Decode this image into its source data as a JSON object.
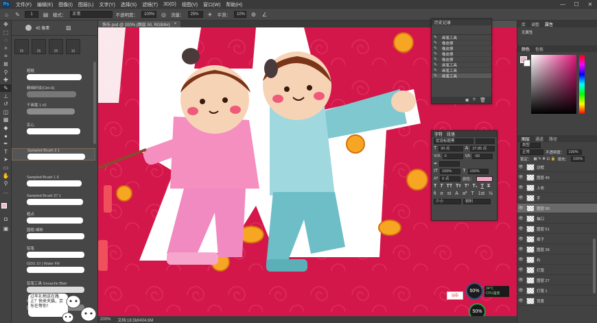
{
  "menubar": {
    "logo": "Ps",
    "items": [
      "文件(F)",
      "编辑(E)",
      "图像(I)",
      "图层(L)",
      "文字(Y)",
      "选择(S)",
      "滤镜(T)",
      "3D(D)",
      "视图(V)",
      "窗口(W)",
      "帮助(H)"
    ],
    "minimize": "—",
    "maximize": "☐",
    "close": "✕"
  },
  "options": {
    "mode_label": "模式：",
    "mode_value": "正常",
    "opacity_label": "不透明度：",
    "opacity_value": "100%",
    "flow_label": "流量：",
    "flow_value": "25%",
    "smooth_label": "平滑：",
    "smooth_value": "10%",
    "brush_size": "1"
  },
  "brushes": {
    "size_value": "45 像素",
    "presets": [
      "25",
      "25",
      "25",
      "10"
    ],
    "items": [
      {
        "name": "粗糙",
        "color": "#ffffff"
      },
      {
        "name": "精细织纹(Ctrl+6)",
        "color": "#9a9a9a"
      },
      {
        "name": "干画笔 1 #2",
        "color": "#bdbdbd"
      },
      {
        "name": "实心",
        "color": "#ffffff"
      },
      {
        "name": "Sampled Brush 3 1",
        "color": "#ffffff"
      },
      {
        "name": "Sampled Brush 1 6",
        "color": "#ffffff"
      },
      {
        "name": "Sampled Brush 37 1",
        "color": "#ffffff"
      },
      {
        "name": "粗点",
        "color": "#ffffff"
      },
      {
        "name": "圆粗-细粉",
        "color": "#ffffff"
      },
      {
        "name": "铅笔",
        "color": "#ffffff"
      },
      {
        "name": "GDG 10 | Water Fill",
        "color": "#ffffff"
      },
      {
        "name": "铅笔工具  Gouache Blair",
        "color": "#dddddd"
      },
      {
        "name": "明暗边缘画笔纹理",
        "color": "#aaaaaa"
      }
    ]
  },
  "doc": {
    "tab_title": "快乐.psd @ 200% (图层 50, RGB/8#)",
    "tab_close": "×",
    "zoom": "200%",
    "doc_info": "文档:18.5M/404.6M"
  },
  "history": {
    "title": "历史记录",
    "items": [
      "画笔工具",
      "橡皮擦",
      "橡皮擦",
      "橡皮擦",
      "橡皮擦",
      "画笔工具",
      "画笔工具",
      "画笔工具"
    ],
    "active_index": 7
  },
  "character": {
    "tabs": [
      "字符",
      "段落"
    ],
    "font": "优设标题黑",
    "size": "30 点",
    "leading": "27.85 点",
    "kerning": "0",
    "tracking": "-50",
    "scale_v": "100%",
    "scale_h": "100%",
    "baseline": "0 点",
    "color_label": "颜色：",
    "color": "#f4a6c8",
    "lang": "英语: 美国",
    "aa": "锐利",
    "letter": "少小"
  },
  "right_dock": {
    "tabs_top": [
      "库",
      "调整",
      "属性"
    ],
    "no_props": "无属性",
    "color_tabs": [
      "颜色",
      "色板"
    ],
    "fg_color": "#f2b8c8",
    "layers_tabs": [
      "图层",
      "通道",
      "路径"
    ],
    "kind": "类型",
    "blend": "正常",
    "opacity_label": "不透明度：",
    "opacity_value": "100%",
    "lock_label": "锁定：",
    "fill_label": "填充：",
    "fill_value": "100%",
    "layers": [
      "边框",
      "图层 49",
      "上衣",
      "手",
      "图层 50",
      "袖口",
      "图层 51",
      "裤子",
      "图层 28",
      "右",
      "灯笼",
      "图层 27",
      "灯笼 1",
      "背景"
    ],
    "selected_layer": 4
  },
  "overlay": {
    "speech": "过年礼物送在路上？快来天猫，京东在等你！",
    "cpu_percent": "50%",
    "cpu_temp": "34°C",
    "cpu_label": "CPU温度",
    "net_percent": "50%",
    "ime": "S中"
  },
  "colors": {
    "canvas_red": "#d3174a",
    "skin": "#f7d3b6",
    "pink_outfit": "#f48fc0",
    "teal_outfit": "#7fc8cf",
    "gold": "#f6a623"
  }
}
